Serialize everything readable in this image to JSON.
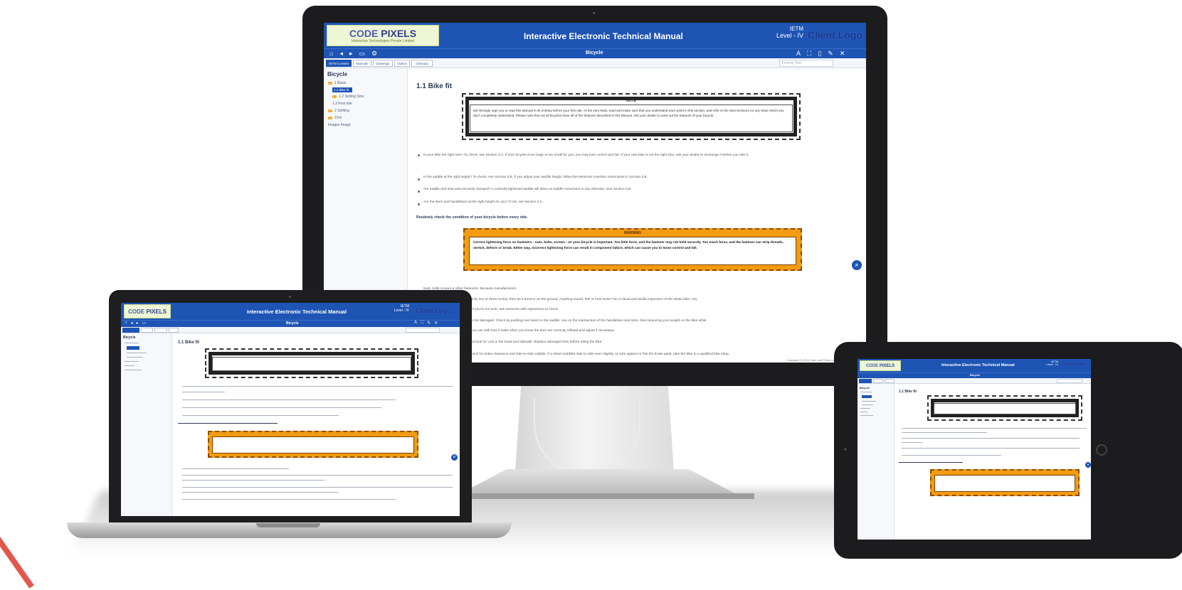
{
  "app": {
    "logo_main": "CODE",
    "logo_pixels": "PIXELS",
    "logo_tagline": "Interactive Technologies Private Limited",
    "title": "Interactive Electronic Technical Manual",
    "ietm_label": "IETM",
    "level_label": "Level - IV",
    "client_logo": "Client Logo",
    "breadcrumb": "Bicycle",
    "tabs": [
      "IETM Content",
      "Manuals",
      "Drawings",
      "Videos",
      "Glossary"
    ],
    "find_placeholder": "Find by Text",
    "toolbar_icons": [
      "home-icon",
      "prev-icon",
      "next-icon",
      "print-icon",
      "settings-icon"
    ],
    "toolbar_right_icons": [
      "font-size-icon",
      "fullscreen-icon",
      "bookmark-icon",
      "pen-icon",
      "close-icon"
    ],
    "sidebar": {
      "root": "Bicycle",
      "items": [
        "1 Basic",
        "1.1 Bike fit",
        "1.2 Setting Sms",
        "1.3 First ride",
        "2 Shifting",
        "3 Kit",
        "Images Image"
      ]
    },
    "content": {
      "heading": "1.1 Bike fit",
      "note_title": "NOTE",
      "note_text": "We strongly urge you to read this Manual in its entirety before your first ride. At the very least, read and make sure that you understand each point in this section, and refer to the cited sections on any issue which you don't completely understand. Please note that not all bicycles have all of the features described in this Manual. Ask your dealer to point out the features of your bicycle.",
      "bullets": [
        "Is your bike the right size? To check, see Section 3.A. If your bicycle is too large or too small for you, you may lose control and fall. If your new bike is not the right size, ask your dealer to exchange it before you ride it.",
        "Is the saddle at the right height? To check, see Section 3.B. If you adjust your saddle height, follow the Minimum Insertion instructions in Section 3.B.",
        "Are saddle and seat post securely clamped? A correctly tightened saddle will allow no saddle movement in any direction. See Section 3.B.",
        "Are the stem and handlebars at the right height for you? If not, see Section 3.C."
      ],
      "routine_heading": "Routinely check the condition of your bicycle before every ride.",
      "caution_title": "WARNING",
      "caution_text": "Correct tightening force on fasteners - nuts, bolts, screws - on your bicycle is important. Too little force, and the fastener may not hold securely. Too much force, and the fastener can strip threads, stretch, deform or break. Either way, incorrect tightening force can result in component failure, which can cause you to loose control and fall.",
      "followup": [
        "Nuts, bolts screws & other fasteners: Because manufacturers",
        "Lift the front wheel off the ground by two or three inches, then let it bounce on the ground. Anything sound, feel or look loose? Do a visual and tactile inspection of the whole bike. Any",
        "loose parts? If so, secure them. If you're not sure, ask someone with experience to check.",
        "Check and make sure the bike is not damaged. Check by pushing one hand on the saddle, one on the intersection of the handlebars and stem, then bouncing your weight on the bike while",
        "pressing down. Complete what you can with how it looks when you know the tires are correctly inflated and adjust if necessary.",
        "Tires: Spin each wheel slowly and look for cuts in the tread and sidewall. Replace damaged tires before riding the bike.",
        "Wheels: Spin each wheel and check for brake clearance and side-to-side wobble. If a wheel wobbles side to side even slightly, or rubs against or hits the brake pads, take the bike to a qualified bike shop."
      ],
      "footer": "Copyright © 2019 Code and Pixels Interactive Technologies"
    }
  }
}
